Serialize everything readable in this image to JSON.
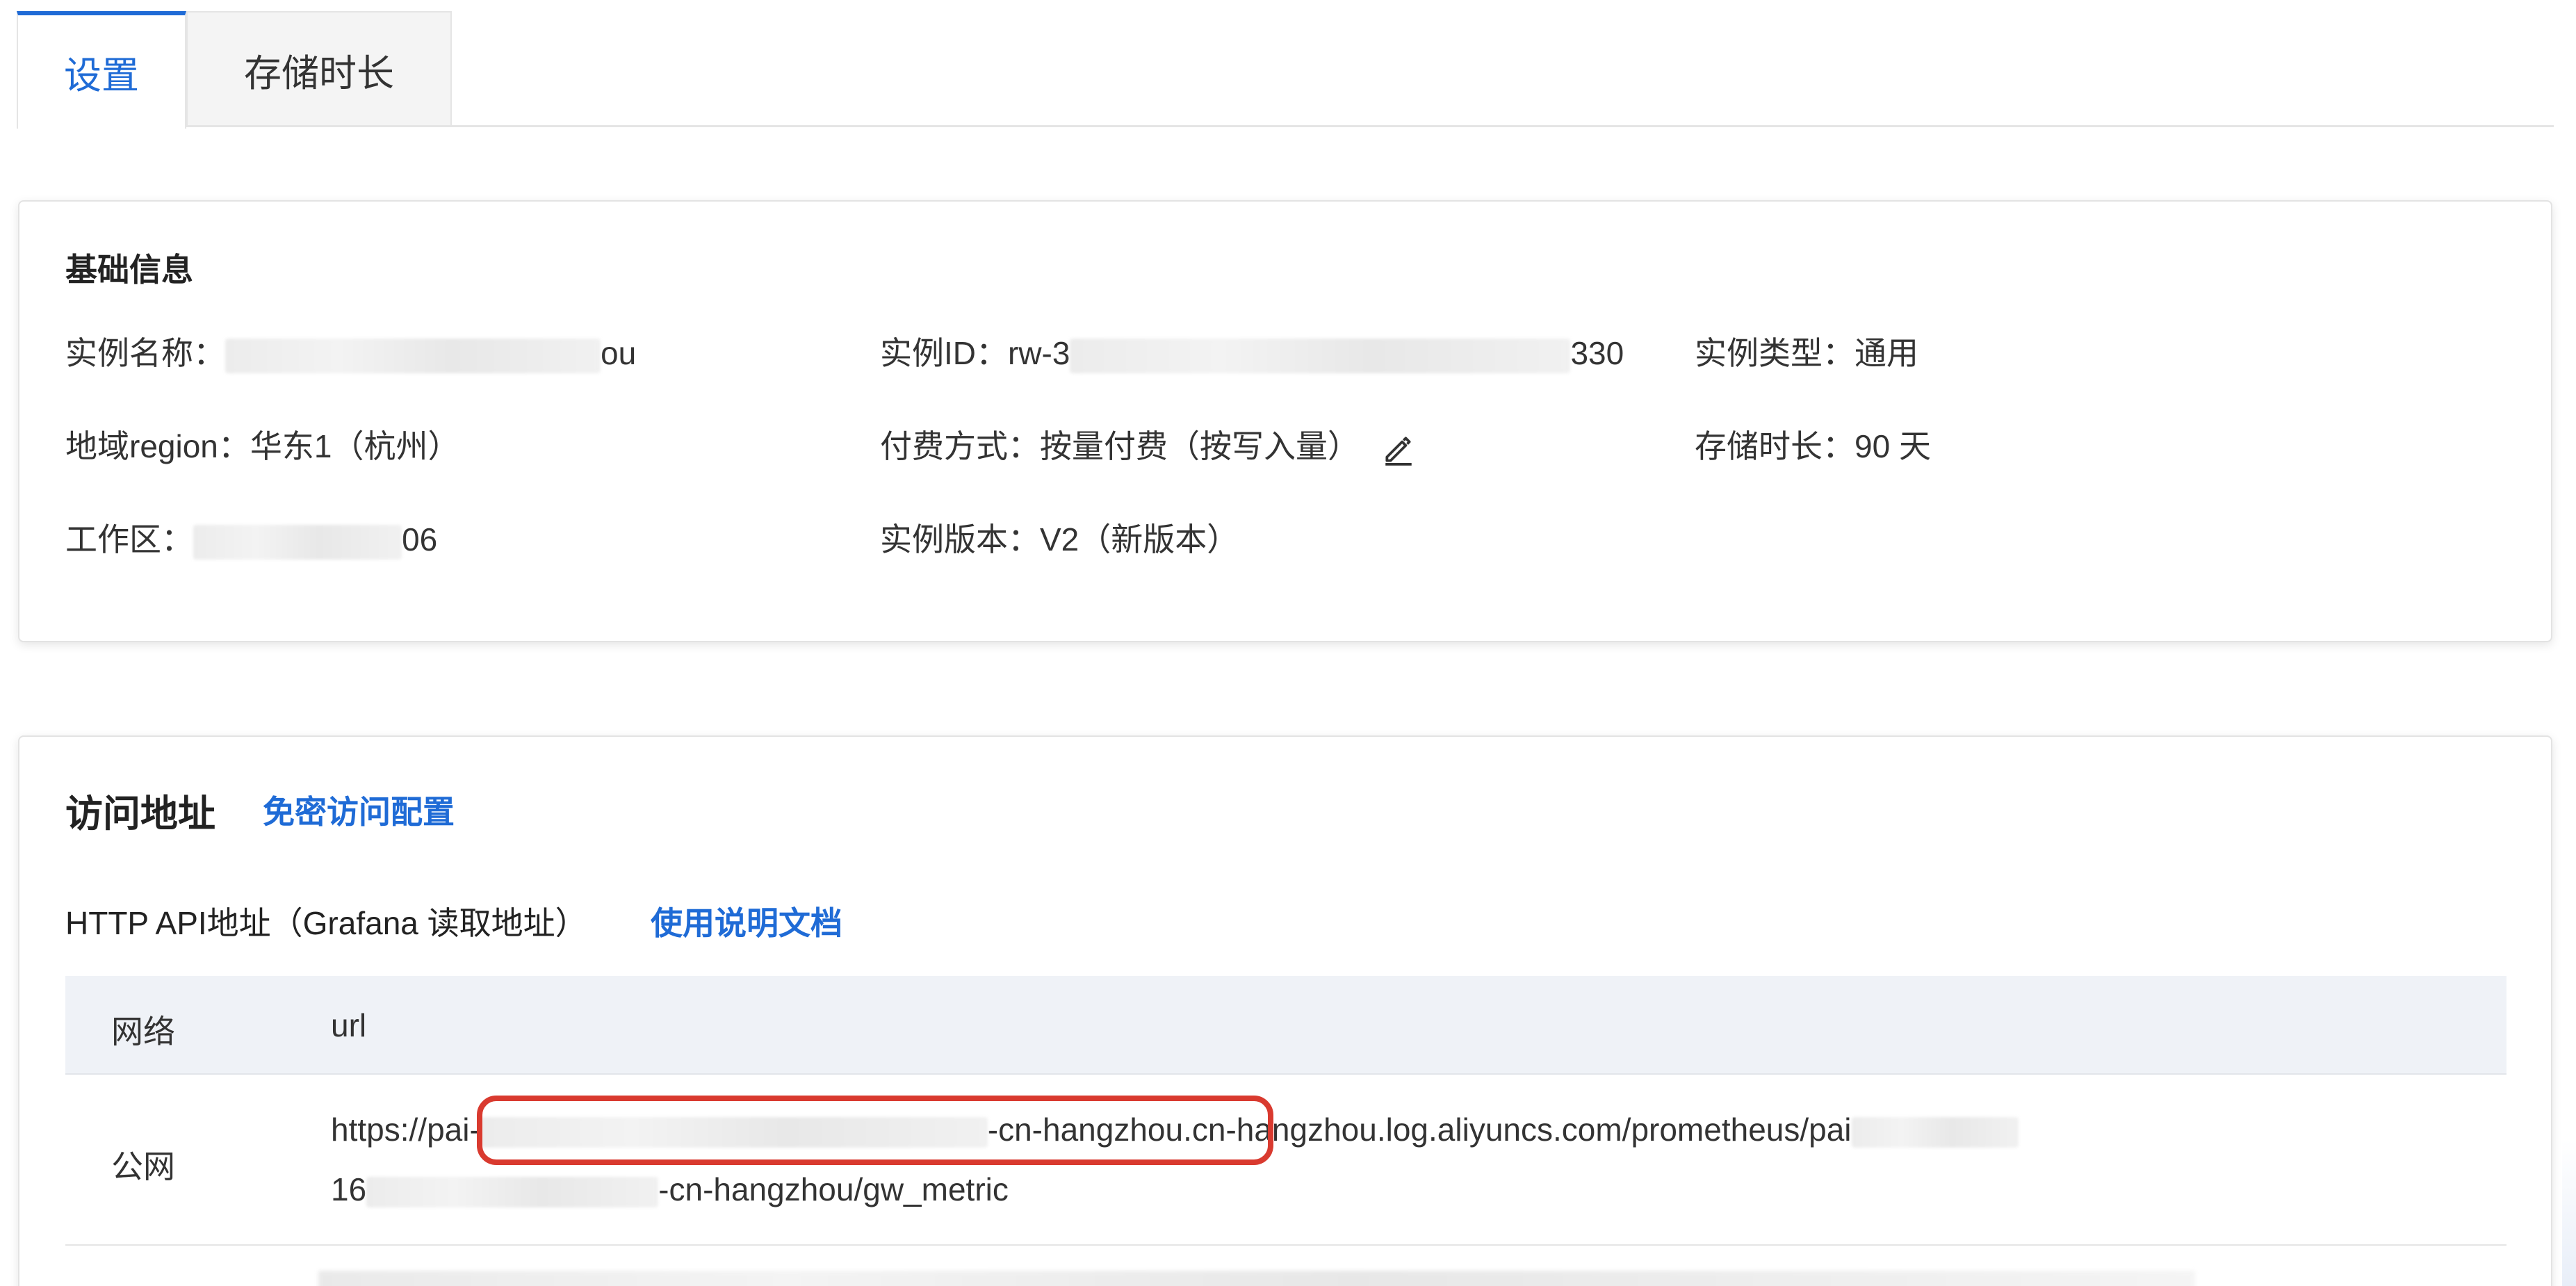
{
  "tabs": [
    {
      "label": "设置",
      "active": true
    },
    {
      "label": "存储时长",
      "active": false
    }
  ],
  "basic_info": {
    "title": "基础信息",
    "instance_name_label": "实例名称：",
    "instance_name_value_suffix": "ou",
    "instance_id_label": "实例ID：",
    "instance_id_prefix": "rw-3",
    "instance_id_suffix": "330",
    "instance_type_label": "实例类型：",
    "instance_type_value": "通用",
    "region_label": "地域region：",
    "region_value": "华东1（杭州）",
    "billing_label": "付费方式：",
    "billing_value": "按量付费（按写入量）",
    "storage_label": "存储时长：",
    "storage_value": "90 天",
    "workspace_label": "工作区：",
    "workspace_value_suffix": "06",
    "version_label": "实例版本：",
    "version_value": "V2（新版本）"
  },
  "access": {
    "title": "访问地址",
    "free_login_link": "免密访问配置",
    "api_label": "HTTP API地址（Grafana 读取地址）",
    "doc_link": "使用说明文档",
    "table": {
      "headers": [
        "网络",
        "url"
      ],
      "rows": [
        {
          "network": "公网",
          "url_line1_prefix": "https://pai-",
          "url_line1_middle": "-cn-hangzhou.cn-hangzhou.log.aliyuncs.com/prometheus/pai",
          "url_line2_prefix": "16",
          "url_line2_suffix": "-cn-hangzhou/gw_metric"
        }
      ]
    }
  },
  "colors": {
    "accent": "#1f6bd6",
    "highlight": "#d93a2f"
  },
  "icons": {
    "edit": "pencil-edit-icon"
  }
}
